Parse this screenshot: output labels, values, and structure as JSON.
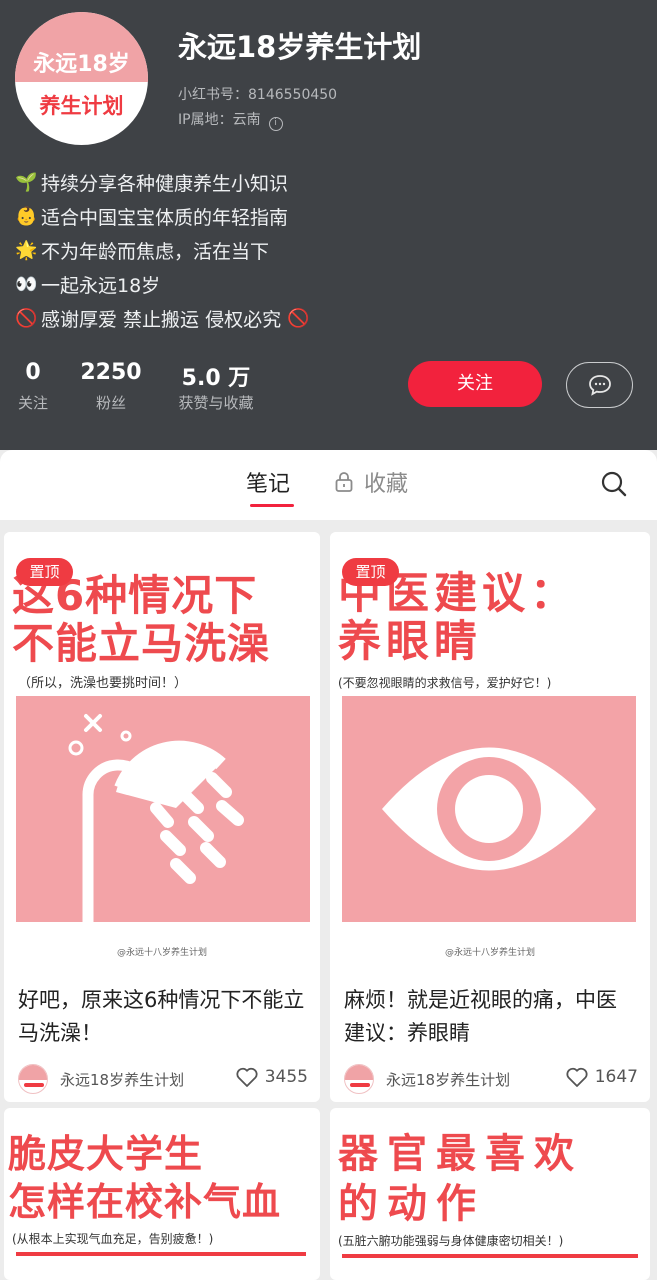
{
  "profile": {
    "avatar_line1": "永远18岁",
    "avatar_line2": "养生计划",
    "name": "永远18岁养生计划",
    "id_text": "小红书号：8146550450",
    "ip_text": "IP属地：云南",
    "bio": [
      {
        "icon": "seedling-icon",
        "glyph": "🌱",
        "text": "持续分享各种健康养生小知识"
      },
      {
        "icon": "baby-icon",
        "glyph": "👶",
        "text": "适合中国宝宝体质的年轻指南"
      },
      {
        "icon": "star-icon",
        "glyph": "🌟",
        "text": "不为年龄而焦虑，活在当下"
      },
      {
        "icon": "eyes-icon",
        "glyph": "👀",
        "text": "一起永远18岁"
      },
      {
        "icon": "prohibited-icon",
        "glyph": "🚫",
        "text": "感谢厚爱 禁止搬运 侵权必究",
        "trailing_glyph": "🚫"
      }
    ],
    "stats": [
      {
        "value": "0",
        "label": "关注"
      },
      {
        "value": "2250",
        "label": "粉丝"
      },
      {
        "value": "5.0 万",
        "label": "获赞与收藏"
      }
    ],
    "follow_label": "关注"
  },
  "tabs": {
    "notes": "笔记",
    "collections": "收藏"
  },
  "notes": [
    {
      "pin": "置顶",
      "headline": [
        "这6种情况下",
        "不能立马洗澡"
      ],
      "subtitle": "（所以，洗澡也要挑时间！）",
      "illustration": "shower-icon",
      "watermark": "@永远十八岁养生计划",
      "title": "好吧，原来这6种情况下不能立马洗澡！",
      "author": "永远18岁养生计划",
      "likes": "3455"
    },
    {
      "pin": "置顶",
      "headline": [
        "中医建议：",
        "养眼睛"
      ],
      "subtitle": "(不要忽视眼睛的求救信号，爱护好它！)",
      "illustration": "eye-icon",
      "watermark": "@永远十八岁养生计划",
      "title": "麻烦！就是近视眼的痛，中医建议：养眼睛",
      "author": "永远18岁养生计划",
      "likes": "1647"
    },
    {
      "headline": [
        "脆皮大学生",
        "怎样在校补气血"
      ],
      "subtitle": "(从根本上实现气血充足，告别疲惫！)"
    },
    {
      "headline": [
        "器官最喜欢",
        "的动作"
      ],
      "subtitle": "(五脏六腑功能强弱与身体健康密切相关！)"
    }
  ],
  "colors": {
    "header_bg": "#3f4246",
    "accent_red": "#f2223d",
    "cover_pink": "#f3a3a7",
    "headline_red": "#ee4a4e"
  }
}
